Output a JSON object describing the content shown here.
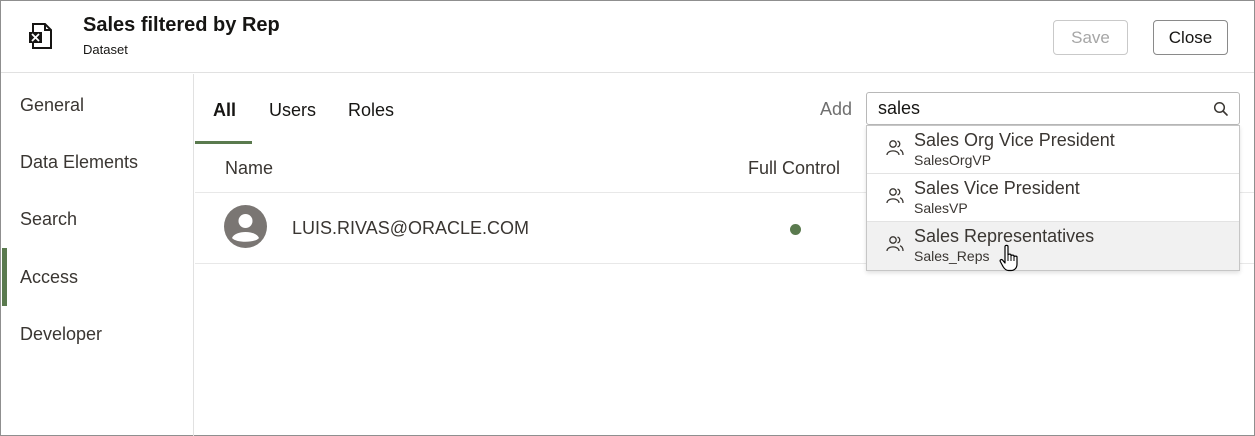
{
  "header": {
    "title": "Sales filtered by Rep",
    "subtitle": "Dataset",
    "icon": "dataset-excel-icon",
    "save_label": "Save",
    "close_label": "Close"
  },
  "sidebar": {
    "items": [
      {
        "label": "General"
      },
      {
        "label": "Data Elements"
      },
      {
        "label": "Search"
      },
      {
        "label": "Access",
        "active": true
      },
      {
        "label": "Developer"
      }
    ]
  },
  "tabs": [
    {
      "label": "All",
      "active": true
    },
    {
      "label": "Users"
    },
    {
      "label": "Roles"
    }
  ],
  "add": {
    "label": "Add",
    "search_value": "sales",
    "icon": "search-icon"
  },
  "table": {
    "columns": [
      "Name",
      "Full Control"
    ],
    "rows": [
      {
        "name": "LUIS.RIVAS@ORACLE.COM",
        "full_control": true
      }
    ]
  },
  "dropdown": {
    "items": [
      {
        "name": "Sales Org Vice President",
        "id": "SalesOrgVP"
      },
      {
        "name": "Sales Vice President",
        "id": "SalesVP"
      },
      {
        "name": "Sales Representatives",
        "id": "Sales_Reps",
        "hovered": true
      }
    ]
  },
  "colors": {
    "accent": "#5a7a4e",
    "border": "#8f8f8f"
  }
}
